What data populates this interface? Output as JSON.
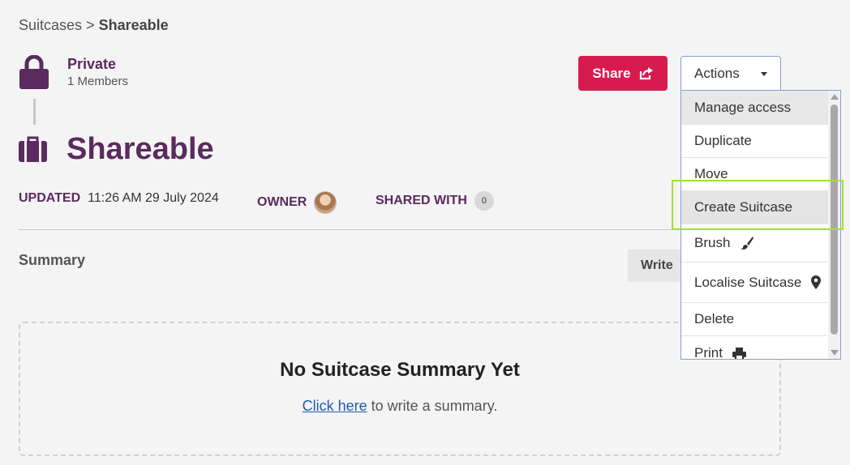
{
  "breadcrumb": {
    "root": "Suitcases",
    "separator": ">",
    "current": "Shareable"
  },
  "owner_group": {
    "name": "Private",
    "members": "1 Members",
    "icon": "lock-icon"
  },
  "title": "Shareable",
  "meta": {
    "updated_label": "UPDATED",
    "updated_value": "11:26 AM 29 July 2024",
    "owner_label": "OWNER",
    "shared_label": "SHARED WITH",
    "shared_count": "0"
  },
  "share_button": {
    "label": "Share",
    "icon": "share-external-icon",
    "color": "#d81b4f"
  },
  "actions": {
    "label": "Actions",
    "items": [
      {
        "label": "Manage access"
      },
      {
        "label": "Duplicate"
      },
      {
        "label": "Move"
      },
      {
        "label": "Create Suitcase"
      },
      {
        "label": "Brush",
        "icon": "paintbrush-icon"
      },
      {
        "label": "Localise Suitcase",
        "icon": "map-pin-icon"
      },
      {
        "label": "Delete"
      },
      {
        "label": "Print",
        "icon": "printer-icon"
      }
    ]
  },
  "summary": {
    "heading": "Summary",
    "write_button": "Write",
    "empty_title": "No Suitcase Summary Yet",
    "empty_link": "Click here",
    "empty_text": " to write a summary."
  },
  "colors": {
    "brand_purple": "#5b2a5e",
    "accent_red": "#d81b4f",
    "link_blue": "#1f5ab8",
    "highlight_green": "#a0e035"
  }
}
